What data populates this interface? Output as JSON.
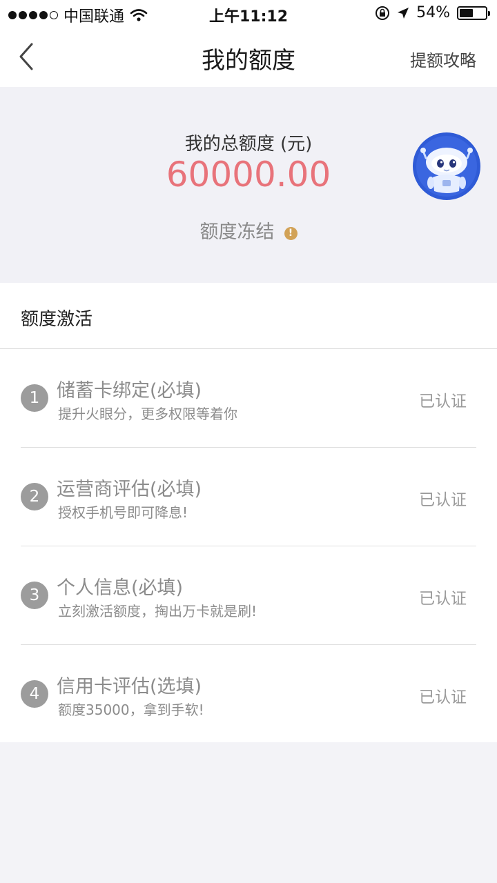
{
  "status_bar": {
    "carrier": "中国联通",
    "time": "上午11:12",
    "battery": "54%",
    "battery_level": 0.54,
    "icons": [
      "signal-dots-icon",
      "wifi-icon",
      "rotation-lock-icon",
      "location-arrow-icon",
      "battery-icon"
    ]
  },
  "nav": {
    "title": "我的额度",
    "right_link": "提额攻略",
    "back_icon": "chevron-left-icon"
  },
  "summary": {
    "label": "我的总额度 (元)",
    "amount": "60000.00",
    "status": "额度冻结",
    "warn_glyph": "!",
    "colors": {
      "amount": "#e8737a",
      "warn": "#d2a257",
      "avatar_bg": "#2f5bd6"
    },
    "avatar_icon": "robot-avatar-icon"
  },
  "activation": {
    "header": "额度激活",
    "items": [
      {
        "num": "1",
        "title": "储蓄卡绑定(必填)",
        "subtitle": "提升火眼分，更多权限等着你",
        "status": "已认证"
      },
      {
        "num": "2",
        "title": "运营商评估(必填)",
        "subtitle": "授权手机号即可降息!",
        "status": "已认证"
      },
      {
        "num": "3",
        "title": "个人信息(必填)",
        "subtitle": "立刻激活额度，掏出万卡就是刷!",
        "status": "已认证"
      },
      {
        "num": "4",
        "title": "信用卡评估(选填)",
        "subtitle": "额度35000，拿到手软!",
        "status": "已认证"
      }
    ]
  }
}
